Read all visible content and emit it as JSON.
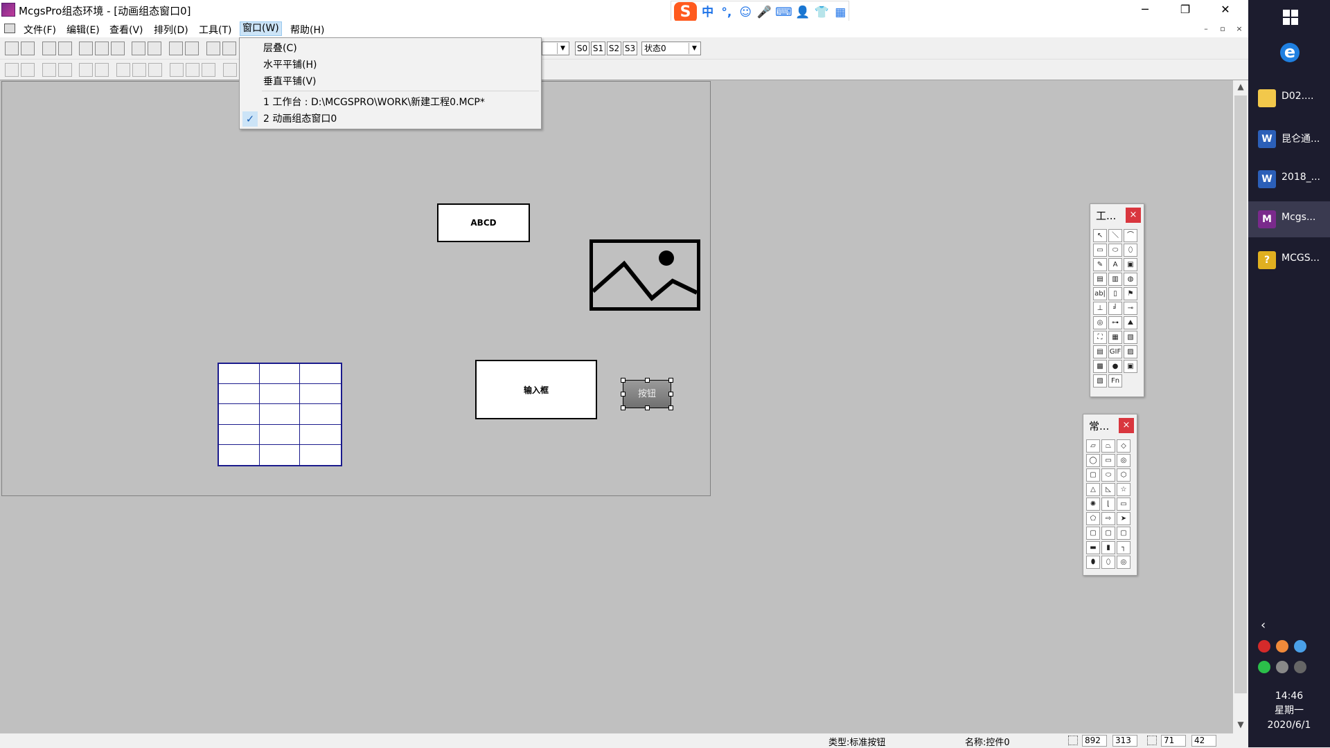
{
  "window": {
    "title": "McgsPro组态环境 - [动画组态窗口0]",
    "controls": {
      "minimize": "─",
      "restore": "❐",
      "close": "✕"
    },
    "mdi_controls": {
      "minimize": "–",
      "restore": "▫",
      "close": "×"
    }
  },
  "menubar": {
    "items": [
      "文件(F)",
      "编辑(E)",
      "查看(V)",
      "排列(D)",
      "工具(T)",
      "窗口(W)",
      "帮助(H)"
    ],
    "active_item": "窗口(W)"
  },
  "ime": {
    "logo": "S",
    "items": [
      "中",
      "°,",
      "☺",
      "🎤",
      "⌨",
      "👤",
      "👕",
      "▦"
    ]
  },
  "toolbar": {
    "state_buttons": [
      "S0",
      "S1",
      "S2",
      "S3"
    ],
    "state_combo": "状态0",
    "combo_arrow": "▼"
  },
  "window_menu": {
    "items": [
      {
        "label": "层叠(C)",
        "checked": false
      },
      {
        "label": "水平平铺(H)",
        "checked": false
      },
      {
        "label": "垂直平铺(V)",
        "checked": false
      }
    ],
    "windows": [
      {
        "label": "1 工作台 : D:\\MCGSPRO\\WORK\\新建工程0.MCP*",
        "checked": false
      },
      {
        "label": "2 动画组态窗口0",
        "checked": true
      }
    ],
    "check_mark": "✓"
  },
  "canvas": {
    "label_object": "ABCD",
    "input_box": "输入框",
    "button_object": "按钮",
    "table": {
      "rows": 5,
      "cols": 3
    }
  },
  "palette_tools": {
    "title": "工...",
    "close": "×",
    "cells": [
      "↖",
      "＼",
      "⌒",
      "▭",
      "⬭",
      "⬯",
      "✎",
      "A",
      "▣",
      "▤",
      "▥",
      "◍",
      "ab|",
      "▯",
      "⚑",
      "⊥",
      "╛",
      "⊸",
      "◎",
      "⊶",
      "⛰",
      "⛶",
      "▦",
      "▧",
      "▤",
      "GIF",
      "▨",
      "▩",
      "●",
      "▣",
      "▧",
      "Fn"
    ]
  },
  "palette_common": {
    "title": "常...",
    "close": "×",
    "cells": [
      "▱",
      "⏢",
      "◇",
      "◯",
      "▭",
      "◎",
      "▢",
      "⬭",
      "⬡",
      "△",
      "◺",
      "☆",
      "✺",
      "⌊",
      "▭",
      "⬠",
      "⇨",
      "➤",
      "▢",
      "▢",
      "▢",
      "▬",
      "▮",
      "┐",
      "⬮",
      "⬯",
      "◎"
    ]
  },
  "statusbar": {
    "type_text": "类型:标准按钮",
    "name_text": "名称:控件0",
    "x": "892",
    "y": "313",
    "w": "71",
    "h": "42"
  },
  "taskbar": {
    "apps": [
      {
        "label": "D02....",
        "icon": "folder-icon",
        "color": "#f2c84b",
        "glyph": ""
      },
      {
        "label": "昆仑通...",
        "icon": "word-icon",
        "color": "#2b5fb8",
        "glyph": "W"
      },
      {
        "label": "2018_...",
        "icon": "word-icon",
        "color": "#2b5fb8",
        "glyph": "W"
      },
      {
        "label": "Mcgs...",
        "icon": "mcgs-icon",
        "color": "#7a2a8c",
        "glyph": "M"
      },
      {
        "label": "MCGS...",
        "icon": "help-icon",
        "color": "#e0b020",
        "glyph": "?"
      }
    ],
    "tray_chevron": "‹",
    "clock": {
      "time": "14:46",
      "weekday": "星期一",
      "date": "2020/6/1"
    }
  }
}
